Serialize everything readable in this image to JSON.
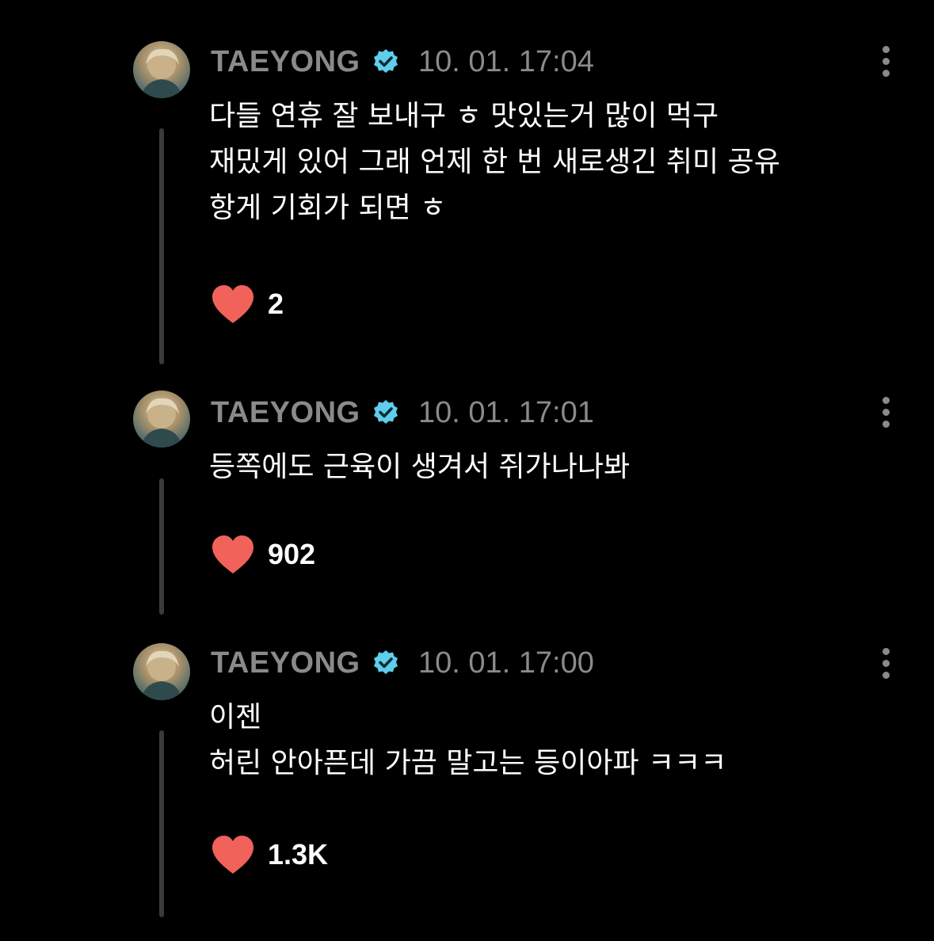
{
  "colors": {
    "background": "#000000",
    "meta_text": "#8a8a8a",
    "verified_badge": "#5fcdec",
    "heart": "#f0625a",
    "thread_line": "#3a3a3a"
  },
  "posts": [
    {
      "author": "TAEYONG",
      "verified_icon": "verified-badge-icon",
      "timestamp": "10. 01. 17:04",
      "lines": [
        "다들 연휴 잘 보내구 ㅎ 맛있는거 많이 먹구",
        "재밌게 있어 그래 언제 한 번 새로생긴 취미 공유",
        "항게 기회가 되면 ㅎ"
      ],
      "likes": "2"
    },
    {
      "author": "TAEYONG",
      "verified_icon": "verified-badge-icon",
      "timestamp": "10. 01. 17:01",
      "lines": [
        "등쪽에도 근육이 생겨서 쥐가나나봐"
      ],
      "likes": "902"
    },
    {
      "author": "TAEYONG",
      "verified_icon": "verified-badge-icon",
      "timestamp": "10. 01. 17:00",
      "lines": [
        "이젠",
        "허린 안아픈데 가끔 말고는 등이아파 ㅋㅋㅋ"
      ],
      "likes": "1.3K"
    }
  ]
}
